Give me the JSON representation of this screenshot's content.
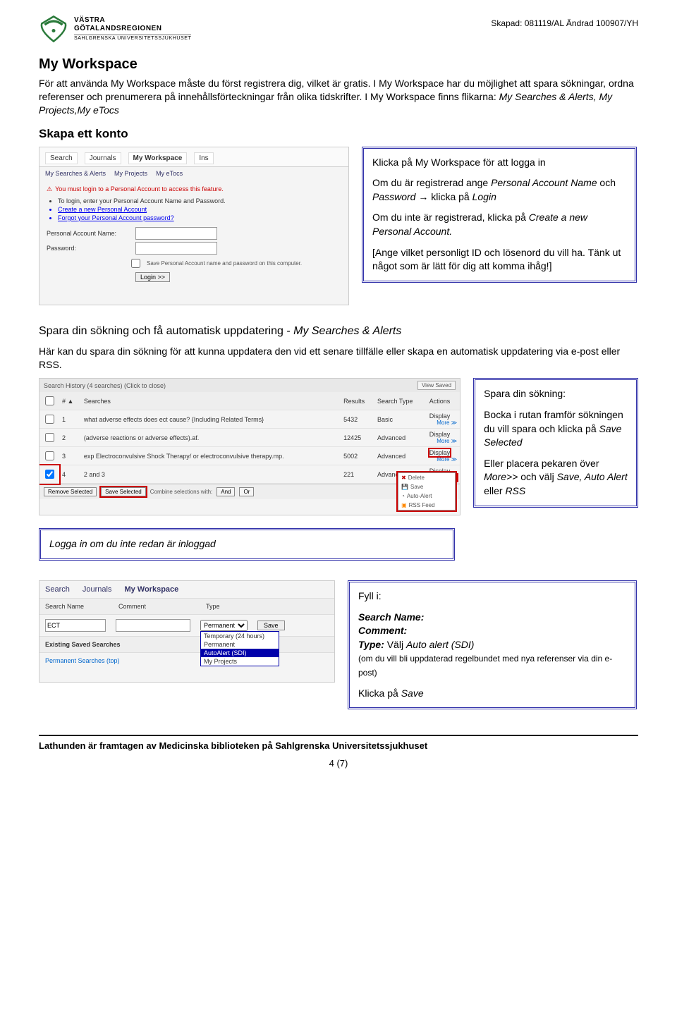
{
  "header": {
    "org_line1": "VÄSTRA",
    "org_line2": "GÖTALANDSREGIONEN",
    "org_line3": "SAHLGRENSKA UNIVERSITETSSJUKHUSET",
    "meta": "Skapad: 081119/AL Ändrad 100907/YH"
  },
  "s1": {
    "title": "My Workspace",
    "p1a": "För att använda My Workspace måste du först registrera dig, vilket är gratis. I My Workspace har du möjlighet att spara sökningar, ordna referenser och prenumerera på innehållsförteckningar från olika tidskrifter. I My Workspace finns flikarna: ",
    "p1b": "My Searches & Alerts, My Projects,My eTocs",
    "sub": "Skapa ett konto"
  },
  "login_sshot": {
    "tabs": [
      "Search",
      "Journals",
      "My Workspace",
      "Ins"
    ],
    "subtabs": [
      "My Searches & Alerts",
      "My Projects",
      "My eTocs"
    ],
    "warn": "You must login to a Personal Account to access this feature.",
    "bullets": [
      "To login, enter your Personal Account Name and Password.",
      "Create a new Personal Account",
      "Forgot your Personal Account password?"
    ],
    "l_user": "Personal Account Name:",
    "l_pass": "Password:",
    "remember": "Save Personal Account name and password on this computer.",
    "login_btn": "Login >>"
  },
  "callout1": {
    "p1": "Klicka på My Workspace för att logga in",
    "p2a": "Om du är registrerad ange ",
    "p2b": "Personal Account Name",
    "p2c": " och ",
    "p2d": "Password",
    "p2e": " → klicka på ",
    "p2f": "Login",
    "p3a": "Om du inte är registrerad, klicka på ",
    "p3b": "Create a new Personal Account.",
    "p4": "[Ange vilket personligt ID och lösenord du vill ha. Tänk ut något som är lätt för dig att komma ihåg!]"
  },
  "s2": {
    "h": "Spara din sökning och få automatisk uppdatering - ",
    "hi": "My Searches & Alerts",
    "p": "Här kan du spara din sökning för att kunna uppdatera den vid ett senare tillfälle eller skapa en automatisk uppdatering via e-post eller RSS."
  },
  "hist": {
    "title": "Search History  (4 searches)  (Click to close)",
    "view_saved": "View Saved",
    "cols": [
      "",
      "# ▲",
      "Searches",
      "Results",
      "Search Type",
      "Actions"
    ],
    "rows": [
      {
        "n": "1",
        "q": "what adverse effects does ect cause? {Including Related Terms}",
        "r": "5432",
        "t": "Basic",
        "a": "Display"
      },
      {
        "n": "2",
        "q": "(adverse reactions or adverse effects).af.",
        "r": "12425",
        "t": "Advanced",
        "a": "Display"
      },
      {
        "n": "3",
        "q": "exp Electroconvulsive Shock Therapy/ or electroconvulsive therapy.mp.",
        "r": "5002",
        "t": "Advanced",
        "a": "Display"
      },
      {
        "n": "4",
        "q": "2 and 3",
        "r": "221",
        "t": "Advanced",
        "a": "Display"
      }
    ],
    "more": "More ≫",
    "remove": "Remove Selected",
    "save": "Save Selected",
    "combine": "Combine selections with:",
    "and": "And",
    "or": "Or",
    "dd": [
      "Delete",
      "Save",
      "Auto-Alert",
      "RSS Feed"
    ]
  },
  "callout2": {
    "t": "Spara din sökning:",
    "p1a": "Bocka i rutan framför sökningen du vill spara och klicka på ",
    "p1b": "Save Selected",
    "p2a": "Eller placera pekaren över ",
    "p2b": "More>>",
    "p2c": " och välj ",
    "p2d": "Save, Auto Alert",
    "p2e": " eller ",
    "p2f": "RSS"
  },
  "callout3": {
    "t": "Logga in om du inte redan är inloggad"
  },
  "ssh3": {
    "nav": [
      "Search",
      "Journals",
      "My Workspace"
    ],
    "cols": [
      "Search Name",
      "Comment",
      "Type"
    ],
    "val_name": "ECT",
    "sel": "Permanent",
    "save": "Save",
    "existing": "Existing Saved Searches",
    "opts": [
      "Temporary (24 hours)",
      "Permanent",
      "AutoAlert (SDI)",
      "My Projects"
    ],
    "perm": "Permanent Searches (top)"
  },
  "callout4": {
    "t": "Fyll i:",
    "l1": "Search Name:",
    "l2": "Comment:",
    "l3a": "Type:",
    "l3b": " Välj ",
    "l3c": "Auto alert (SDI)",
    "note": "(om du vill bli uppdaterad regelbundet med nya referenser via din e-post)",
    "last": "Klicka på ",
    "lastb": "Save"
  },
  "footer": {
    "line": "Lathunden är framtagen av Medicinska biblioteken på Sahlgrenska Universitetssjukhuset",
    "page": "4 (7)"
  }
}
